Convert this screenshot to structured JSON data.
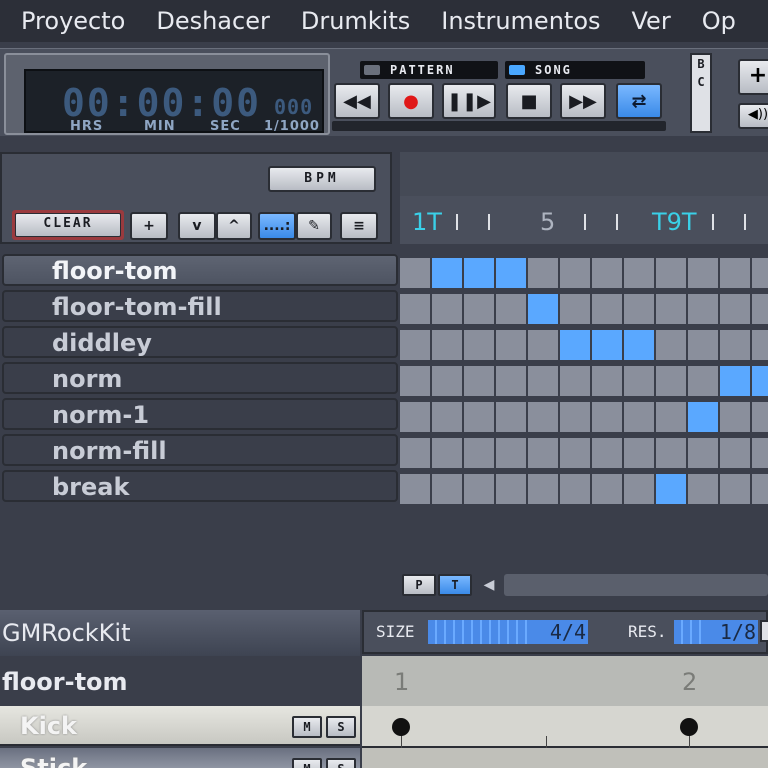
{
  "menu": [
    {
      "label": "Proyecto"
    },
    {
      "label": "Deshacer"
    },
    {
      "label": "Drumkits"
    },
    {
      "label": "Instrumentos"
    },
    {
      "label": "Ver"
    },
    {
      "label": "Op"
    }
  ],
  "transport": {
    "time": "00:00:00",
    "ms": "000",
    "labels": {
      "hrs": "HRS",
      "min": "MIN",
      "sec": "SEC",
      "ms": "1/1000"
    },
    "pattern_mode": "PATTERN",
    "song_mode": "SONG",
    "song_mode_active": true,
    "buttons": {
      "rewind": "◀◀",
      "record": "●",
      "play_pause": "❚❚▶",
      "stop": "■",
      "forward": "▶▶",
      "loop": "⇄"
    },
    "bc_label_b": "B",
    "bc_label_c": "C",
    "zoom_in": "+",
    "speaker": "◀))"
  },
  "song_editor": {
    "bpm_label": "BPM",
    "clear_label": "CLEAR",
    "add_label": "+",
    "down_label": "v",
    "up_label": "^",
    "select_mode_label": "....:",
    "draw_mode_label": "✎",
    "list_mode_label": "≡",
    "ruler_labels": [
      {
        "text": "1T",
        "tag": true
      },
      {
        "text": "5",
        "tag": false
      },
      {
        "text": "T9T",
        "tag": true
      }
    ],
    "patterns": [
      {
        "name": "floor-tom",
        "selected": true
      },
      {
        "name": "floor-tom-fill",
        "selected": false
      },
      {
        "name": "diddley",
        "selected": false
      },
      {
        "name": "norm",
        "selected": false
      },
      {
        "name": "norm-1",
        "selected": false
      },
      {
        "name": "norm-fill",
        "selected": false
      },
      {
        "name": "break",
        "selected": false
      }
    ],
    "grid_active": [
      [
        1,
        2,
        3
      ],
      [
        4
      ],
      [
        5,
        6,
        7
      ],
      [
        10,
        11
      ],
      [
        9
      ],
      [],
      [
        8
      ]
    ],
    "grid_columns": 12,
    "p_label": "P",
    "t_label": "T"
  },
  "pattern_editor": {
    "kit_name": "GMRockKit",
    "pattern_name": "floor-tom",
    "size_label": "SIZE",
    "size_value": "4/4",
    "res_label": "RES.",
    "res_value": "1/8",
    "beats": [
      "1",
      "2"
    ],
    "instruments": [
      {
        "name": "Kick",
        "mute": "M",
        "solo": "S"
      },
      {
        "name": "Stick",
        "mute": "M",
        "solo": "S"
      }
    ],
    "kick_notes": [
      1,
      2
    ]
  }
}
